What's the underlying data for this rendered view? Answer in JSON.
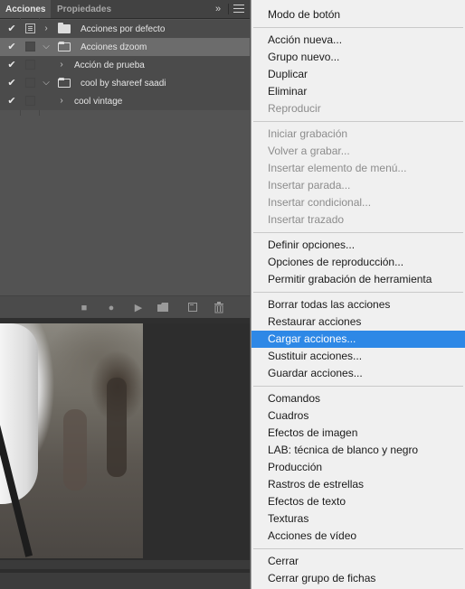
{
  "panel": {
    "tabs": [
      {
        "label": "Acciones",
        "active": true
      },
      {
        "label": "Propiedades",
        "active": false
      }
    ],
    "expand_icon": "double-chevron-right-icon",
    "menu_icon": "hamburger-menu-icon",
    "rows": [
      {
        "label": "Acciones por defecto",
        "kind": "set",
        "expanded": false,
        "checked": true,
        "dialog": true
      },
      {
        "label": "Acciones dzoom",
        "kind": "set",
        "expanded": true,
        "checked": true,
        "dialog": false
      },
      {
        "label": "Acción de prueba",
        "kind": "action",
        "expanded": false,
        "checked": true,
        "dialog": false
      },
      {
        "label": "cool by shareef saadi",
        "kind": "set",
        "expanded": true,
        "checked": true,
        "dialog": false
      },
      {
        "label": "cool vintage",
        "kind": "action",
        "expanded": false,
        "checked": true,
        "dialog": false
      }
    ],
    "toolbar_icons": [
      "stop-icon",
      "record-icon",
      "play-icon",
      "new-set-icon",
      "new-action-icon",
      "trash-icon"
    ]
  },
  "menu": {
    "groups": [
      [
        {
          "label": "Modo de botón",
          "enabled": true
        }
      ],
      [
        {
          "label": "Acción nueva...",
          "enabled": true
        },
        {
          "label": "Grupo nuevo...",
          "enabled": true
        },
        {
          "label": "Duplicar",
          "enabled": true
        },
        {
          "label": "Eliminar",
          "enabled": true
        },
        {
          "label": "Reproducir",
          "enabled": false
        }
      ],
      [
        {
          "label": "Iniciar grabación",
          "enabled": false
        },
        {
          "label": "Volver a grabar...",
          "enabled": false
        },
        {
          "label": "Insertar elemento de menú...",
          "enabled": false
        },
        {
          "label": "Insertar parada...",
          "enabled": false
        },
        {
          "label": "Insertar condicional...",
          "enabled": false
        },
        {
          "label": "Insertar trazado",
          "enabled": false
        }
      ],
      [
        {
          "label": "Definir opciones...",
          "enabled": true
        },
        {
          "label": "Opciones de reproducción...",
          "enabled": true
        },
        {
          "label": "Permitir grabación de herramienta",
          "enabled": true
        }
      ],
      [
        {
          "label": "Borrar todas las acciones",
          "enabled": true
        },
        {
          "label": "Restaurar acciones",
          "enabled": true
        },
        {
          "label": "Cargar acciones...",
          "enabled": true,
          "highlighted": true
        },
        {
          "label": "Sustituir acciones...",
          "enabled": true
        },
        {
          "label": "Guardar acciones...",
          "enabled": true
        }
      ],
      [
        {
          "label": "Comandos",
          "enabled": true
        },
        {
          "label": "Cuadros",
          "enabled": true
        },
        {
          "label": "Efectos de imagen",
          "enabled": true
        },
        {
          "label": "LAB: técnica de blanco y negro",
          "enabled": true
        },
        {
          "label": "Producción",
          "enabled": true
        },
        {
          "label": "Rastros de estrellas",
          "enabled": true
        },
        {
          "label": "Efectos de texto",
          "enabled": true
        },
        {
          "label": "Texturas",
          "enabled": true
        },
        {
          "label": "Acciones de vídeo",
          "enabled": true
        }
      ],
      [
        {
          "label": "Cerrar",
          "enabled": true
        },
        {
          "label": "Cerrar grupo de fichas",
          "enabled": true
        }
      ]
    ]
  },
  "colors": {
    "panel_bg": "#535353",
    "menu_bg": "#f0f0f0",
    "highlight": "#2e88e6",
    "disabled_text": "#8c8c8c"
  }
}
